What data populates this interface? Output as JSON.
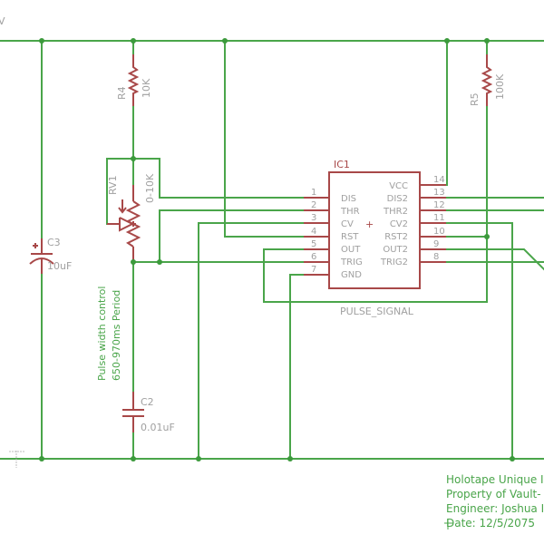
{
  "schematic": {
    "top_rail_label_fragment": "V",
    "colors": {
      "wire": "#4aa54a",
      "part": "#a84848",
      "label": "#a0a0a0",
      "background": "#ffffff"
    },
    "components": {
      "r4": {
        "name": "R4",
        "value": "10K"
      },
      "r5": {
        "name": "R5",
        "value": "100K"
      },
      "rv1": {
        "name": "RV1",
        "value": "0-10K"
      },
      "c3": {
        "name": "C3",
        "value": "10uF"
      },
      "c2": {
        "name": "C2",
        "value": "0.01uF"
      },
      "ic1": {
        "name": "IC1",
        "center_mark": "+",
        "left_pins": [
          {
            "num": "1",
            "name": "DIS"
          },
          {
            "num": "2",
            "name": "THR"
          },
          {
            "num": "3",
            "name": "CV"
          },
          {
            "num": "4",
            "name": "RST"
          },
          {
            "num": "5",
            "name": "OUT"
          },
          {
            "num": "6",
            "name": "TRIG"
          },
          {
            "num": "7",
            "name": "GND"
          }
        ],
        "right_pins": [
          {
            "num": "14",
            "name": "VCC"
          },
          {
            "num": "13",
            "name": "DIS2"
          },
          {
            "num": "12",
            "name": "THR2"
          },
          {
            "num": "11",
            "name": "CV2"
          },
          {
            "num": "10",
            "name": "RST2"
          },
          {
            "num": "9",
            "name": "OUT2"
          },
          {
            "num": "8",
            "name": "TRIG2"
          }
        ]
      }
    },
    "net_label": "PULSE_SIGNAL",
    "note_lines": [
      "Pulse width control",
      "650-970ms Period"
    ],
    "title_block": {
      "line1": "Holotape Unique I",
      "line2": "Property of Vault-",
      "line3": "Engineer: Joshua I",
      "line4": "Date: 12/5/2075"
    }
  }
}
